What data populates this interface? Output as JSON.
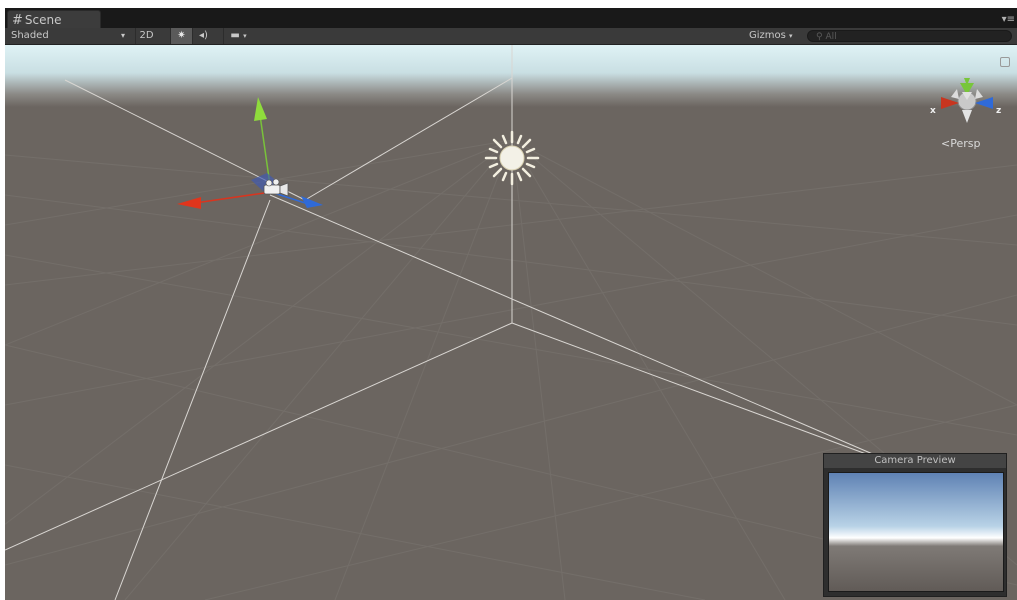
{
  "tab": {
    "title": "Scene",
    "icon": "scene-grid-icon",
    "menu_icon": "tab-menu-icon"
  },
  "toolbar": {
    "shading_mode": "Shaded",
    "btn_2d": "2D",
    "lighting_icon": "sun-icon",
    "audio_icon": "speaker-icon",
    "effects_icon": "image-icon",
    "gizmos_label": "Gizmos",
    "search_placeholder": "All"
  },
  "viewport": {
    "projection_label": "Persp",
    "axes": {
      "x": "x",
      "y": "y",
      "z": "z"
    }
  },
  "camera_preview": {
    "title": "Camera Preview"
  },
  "colors": {
    "sky_top": "#dcf0f4",
    "ground": "#6b6560",
    "axis_x": "#d8351f",
    "axis_y": "#7ccb32",
    "axis_z": "#2f6ad8"
  }
}
